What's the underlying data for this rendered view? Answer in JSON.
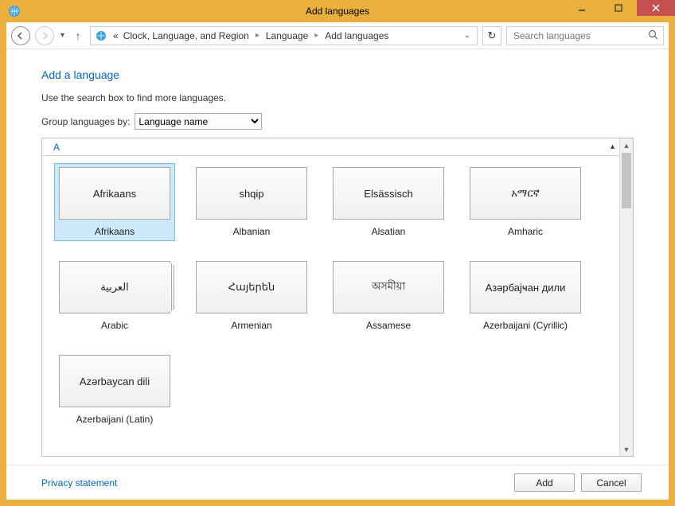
{
  "window": {
    "title": "Add languages"
  },
  "breadcrumb": {
    "prefix": "«",
    "items": [
      "Clock, Language, and Region",
      "Language",
      "Add languages"
    ]
  },
  "search": {
    "placeholder": "Search languages"
  },
  "page": {
    "heading": "Add a language",
    "hint": "Use the search box to find more languages.",
    "group_label": "Group languages by:",
    "group_value": "Language name"
  },
  "letter_header": "A",
  "languages": [
    {
      "native": "Afrikaans",
      "english": "Afrikaans",
      "selected": true,
      "stack": false
    },
    {
      "native": "shqip",
      "english": "Albanian",
      "selected": false,
      "stack": false
    },
    {
      "native": "Elsässisch",
      "english": "Alsatian",
      "selected": false,
      "stack": false
    },
    {
      "native": "አማርኛ",
      "english": "Amharic",
      "selected": false,
      "stack": false
    },
    {
      "native": "العربية",
      "english": "Arabic",
      "selected": false,
      "stack": true
    },
    {
      "native": "Հայերեն",
      "english": "Armenian",
      "selected": false,
      "stack": false
    },
    {
      "native": "অসমীয়া",
      "english": "Assamese",
      "selected": false,
      "stack": false
    },
    {
      "native": "Азәрбајҹан дили",
      "english": "Azerbaijani (Cyrillic)",
      "selected": false,
      "stack": false
    },
    {
      "native": "Azərbaycan dili",
      "english": "Azerbaijani (Latin)",
      "selected": false,
      "stack": false
    }
  ],
  "footer": {
    "privacy": "Privacy statement",
    "add": "Add",
    "cancel": "Cancel"
  }
}
